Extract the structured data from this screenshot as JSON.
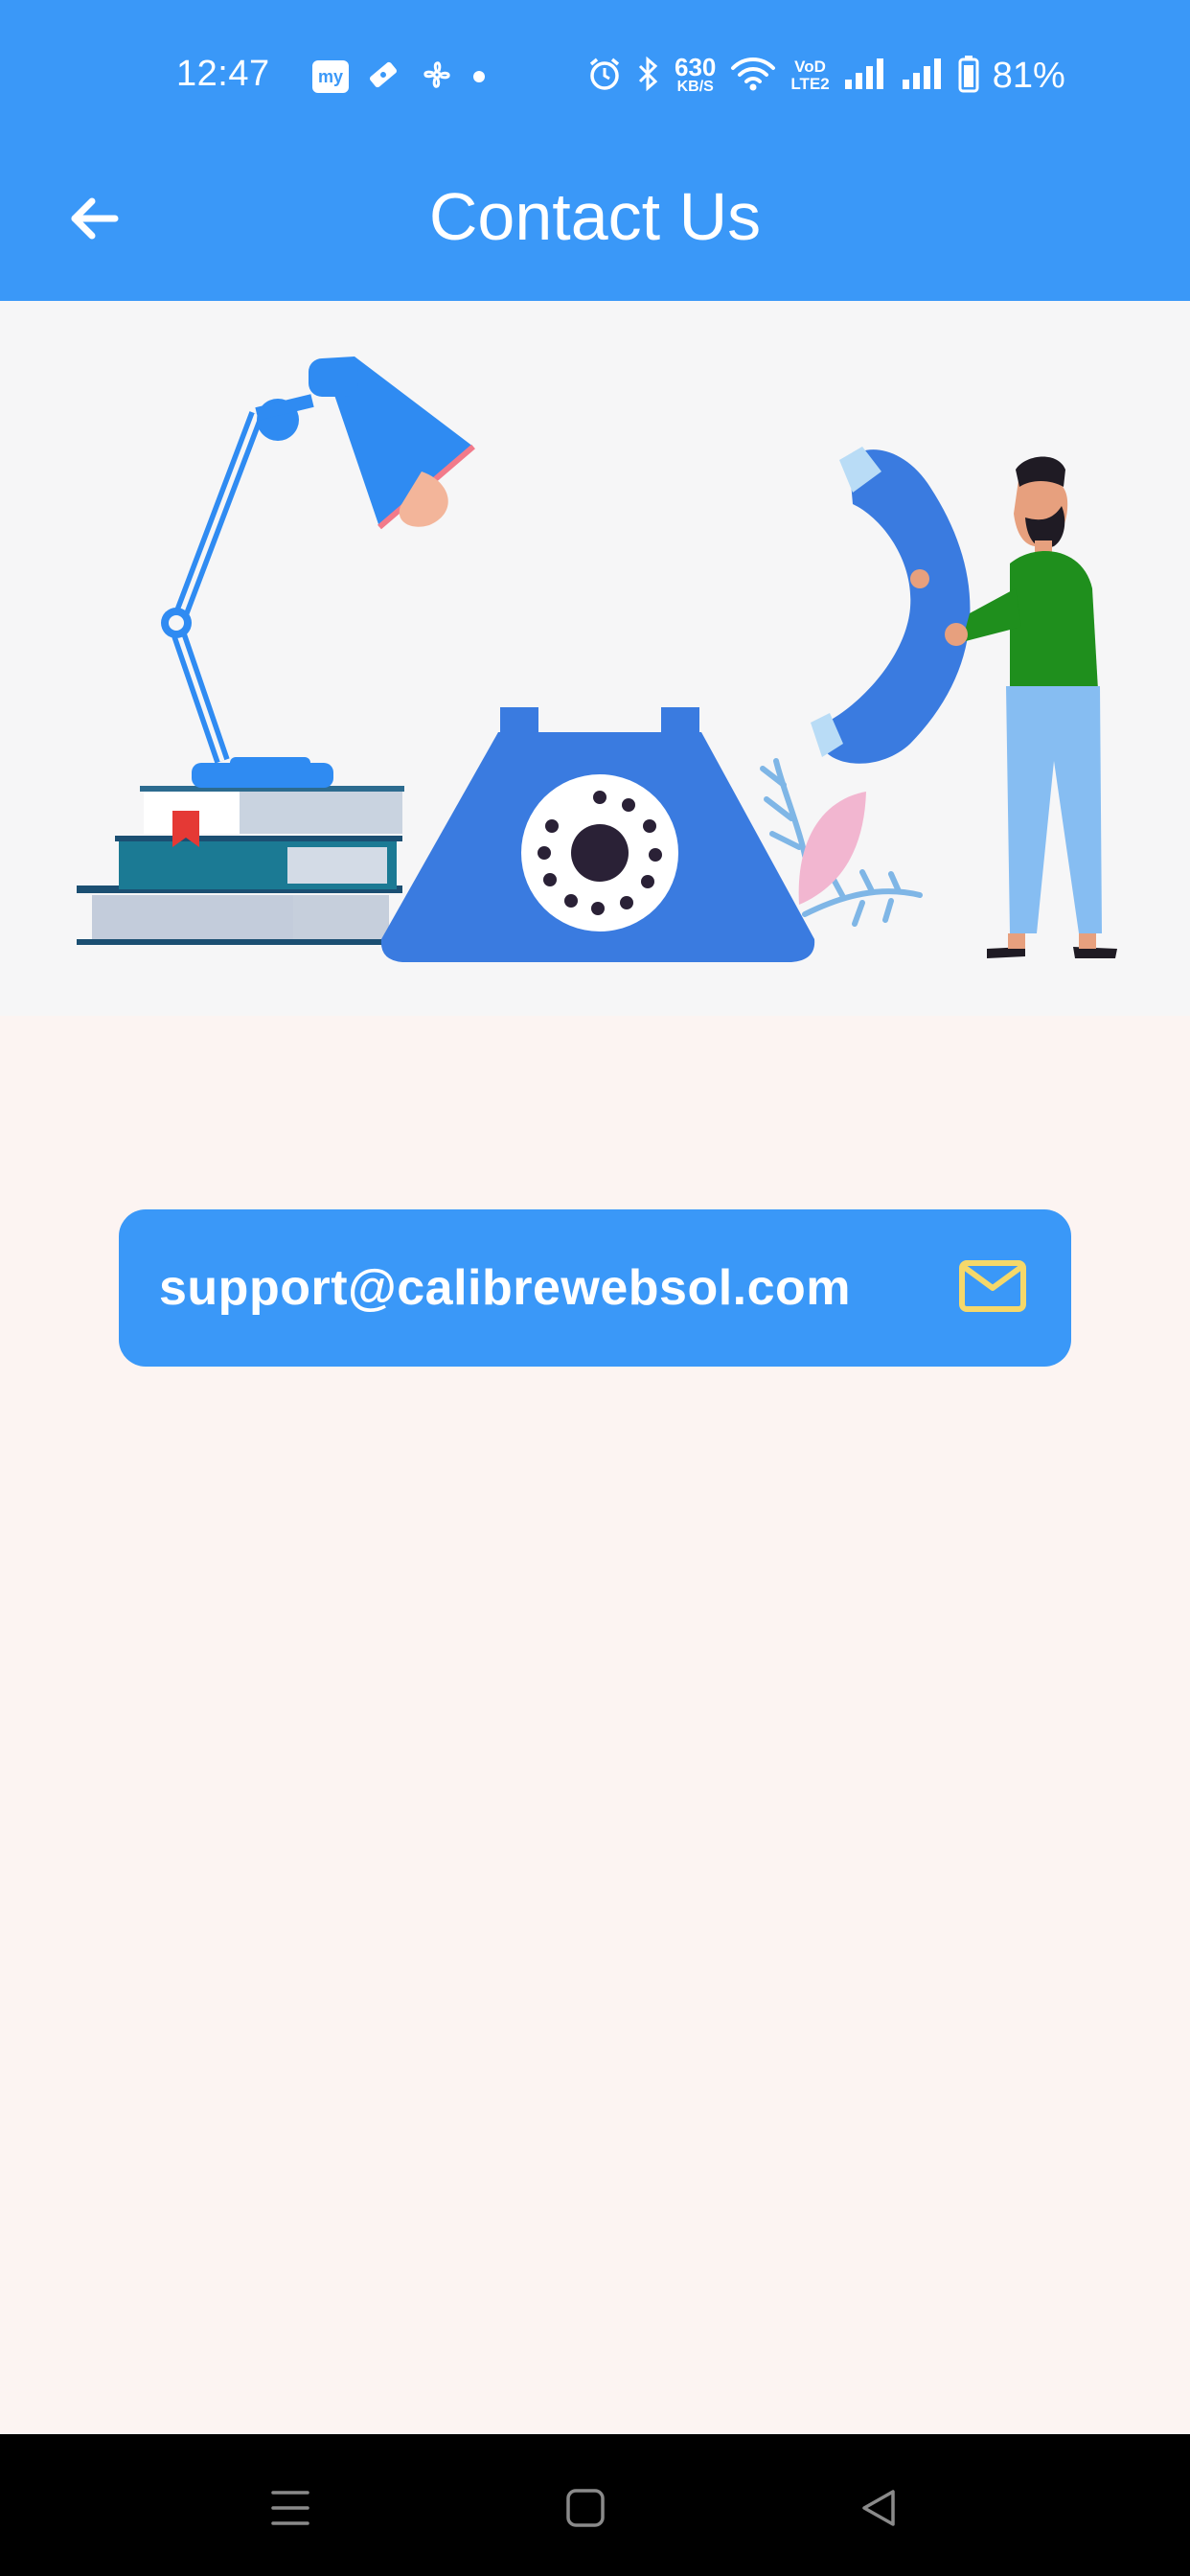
{
  "status_bar": {
    "time": "12:47",
    "my_tile": "my",
    "net_speed_value": "630",
    "net_speed_unit": "KB/S",
    "volte_line1": "VoD",
    "volte_line2": "LTE2",
    "battery_percent": "81%",
    "icons": [
      "my-app-icon",
      "ticket-icon",
      "fan-icon",
      "notification-dot",
      "alarm-icon",
      "bluetooth-icon",
      "wifi-icon",
      "signal-icon",
      "signal-icon",
      "battery-icon"
    ]
  },
  "app_bar": {
    "title": "Contact Us",
    "back_icon": "arrow-left-icon"
  },
  "illustration": {
    "description_icon": "contact-illustration"
  },
  "contact": {
    "email": "support@calibrewebsol.com",
    "email_icon": "mail-icon"
  },
  "navigation_bar": {
    "icons": [
      "menu-icon",
      "home-icon",
      "back-triangle-icon"
    ]
  },
  "colors": {
    "primary": "#3a98f8",
    "background": "#fcf4f2",
    "illustration_bg": "#f6f6f7",
    "mail_icon": "#f5d86a",
    "nav_bar": "#000000"
  }
}
